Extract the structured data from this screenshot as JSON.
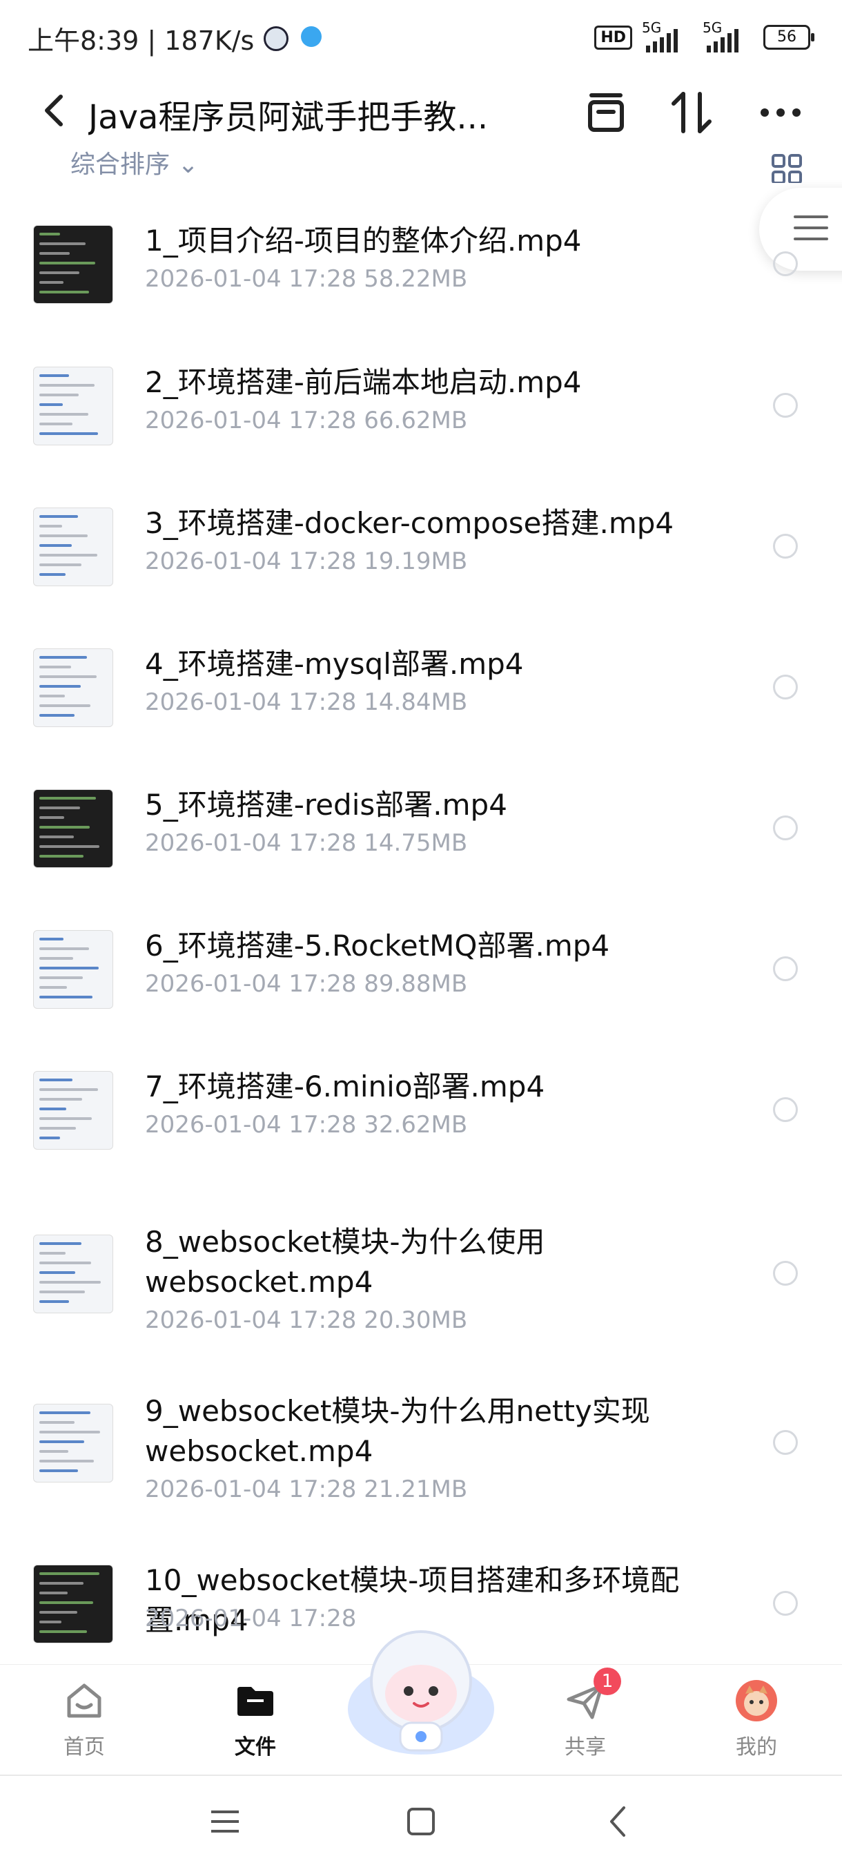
{
  "status": {
    "time": "上午8:39 | 187K/s",
    "hd": "HD",
    "net1": "5G",
    "net2": "5G",
    "battery": "56"
  },
  "header": {
    "title": "Java程序员阿斌手把手教...",
    "sort_label": "综合排序"
  },
  "files": [
    {
      "name": "1_项目介绍-项目的整体介绍.mp4",
      "date": "2026-01-04  17:28",
      "size": "58.22MB",
      "thumb": "dark"
    },
    {
      "name": "2_环境搭建-前后端本地启动.mp4",
      "date": "2026-01-04  17:28",
      "size": "66.62MB",
      "thumb": "light"
    },
    {
      "name": "3_环境搭建-docker-compose搭建.mp4",
      "date": "2026-01-04  17:28",
      "size": "19.19MB",
      "thumb": "light"
    },
    {
      "name": "4_环境搭建-mysql部署.mp4",
      "date": "2026-01-04  17:28",
      "size": "14.84MB",
      "thumb": "light"
    },
    {
      "name": "5_环境搭建-redis部署.mp4",
      "date": "2026-01-04  17:28",
      "size": "14.75MB",
      "thumb": "dark"
    },
    {
      "name": "6_环境搭建-5.RocketMQ部署.mp4",
      "date": "2026-01-04  17:28",
      "size": "89.88MB",
      "thumb": "light"
    },
    {
      "name": "7_环境搭建-6.minio部署.mp4",
      "date": "2026-01-04  17:28",
      "size": "32.62MB",
      "thumb": "light"
    },
    {
      "name": "8_websocket模块-为什么使用websocket.mp4",
      "date": "2026-01-04  17:28",
      "size": "20.30MB",
      "thumb": "light"
    },
    {
      "name": "9_websocket模块-为什么用netty实现websocket.mp4",
      "date": "2026-01-04  17:28",
      "size": "21.21MB",
      "thumb": "light"
    },
    {
      "name": "10_websocket模块-项目搭建和多环境配置.mp4",
      "date": "2026-01-04  17:28",
      "size": "",
      "thumb": "dark"
    }
  ],
  "tabs": [
    {
      "label": "首页",
      "icon": "home-icon"
    },
    {
      "label": "文件",
      "icon": "folder-icon"
    },
    {
      "label": "共享",
      "icon": "send-icon",
      "badge": "1"
    },
    {
      "label": "我的",
      "icon": "avatar-icon"
    }
  ],
  "colors": {
    "accent": "#111111",
    "muted": "#a4a9b3",
    "badge": "#f24a5c"
  }
}
